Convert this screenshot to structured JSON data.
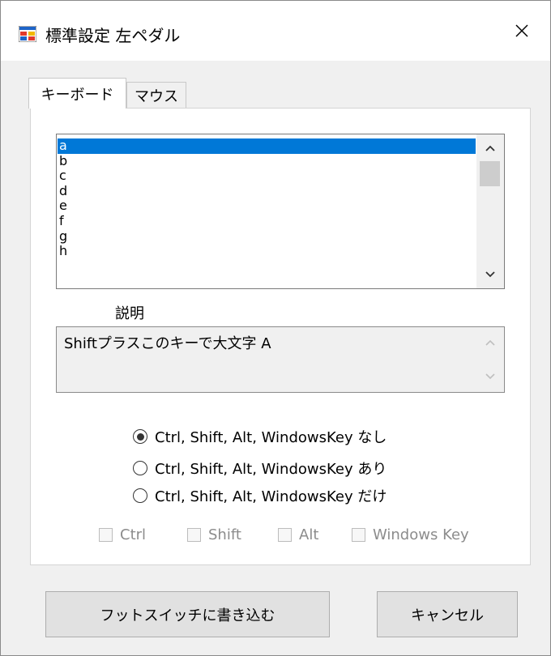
{
  "window": {
    "title": "標準設定 左ペダル",
    "icon": "app-form-icon",
    "close_icon": "close-icon"
  },
  "tabs": [
    {
      "label": "キーボード",
      "active": true
    },
    {
      "label": "マウス",
      "active": false
    }
  ],
  "key_list": {
    "items": [
      "a",
      "b",
      "c",
      "d",
      "e",
      "f",
      "g",
      "h"
    ],
    "selected": "a"
  },
  "description": {
    "label": "説明",
    "text": "Shiftプラスこのキーで大文字 A"
  },
  "modifier_options": [
    {
      "label": "Ctrl, Shift, Alt, WindowsKey なし",
      "checked": true
    },
    {
      "label": "Ctrl, Shift, Alt, WindowsKey あり",
      "checked": false
    },
    {
      "label": "Ctrl, Shift, Alt, WindowsKey だけ",
      "checked": false
    }
  ],
  "modifier_checks": [
    {
      "label": "Ctrl",
      "checked": false,
      "enabled": false
    },
    {
      "label": "Shift",
      "checked": false,
      "enabled": false
    },
    {
      "label": "Alt",
      "checked": false,
      "enabled": false
    },
    {
      "label": "Windows Key",
      "checked": false,
      "enabled": false
    }
  ],
  "buttons": {
    "write": "フットスイッチに書き込む",
    "cancel": "キャンセル"
  },
  "colors": {
    "selection": "#0078d7",
    "window_bg": "#f0f0f0",
    "disabled_text": "#8c8c8c"
  }
}
